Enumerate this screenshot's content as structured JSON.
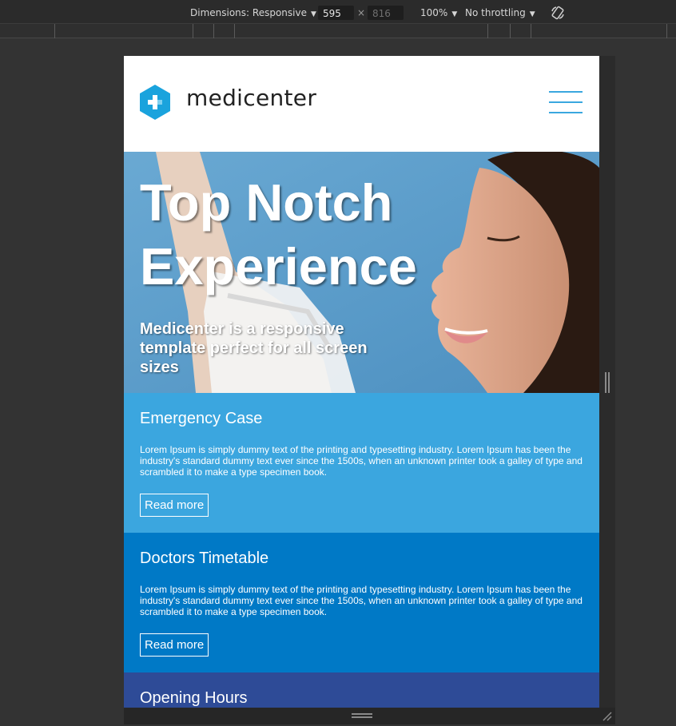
{
  "devtools": {
    "dimensions_label": "Dimensions: Responsive",
    "width_value": "595",
    "height_value": "816",
    "times": "×",
    "zoom": "100%",
    "throttling": "No throttling",
    "caret": "▼",
    "rotate_icon": "rotate-icon"
  },
  "site": {
    "logo_text": "medicenter",
    "logo_icon": "medical-cross-icon",
    "menu_icon": "hamburger-menu-icon",
    "brand_color": "#3aa7df"
  },
  "hero": {
    "title": "Top Notch Experience",
    "subtitle": "Medicenter is a responsive template perfect for all screen sizes"
  },
  "boxes": [
    {
      "title": "Emergency Case",
      "text": "Lorem Ipsum is simply dummy text of the printing and typesetting industry. Lorem Ipsum has been the industry's standard dummy text ever since the 1500s, when an unknown printer took a galley of type and scrambled it to make a type specimen book.",
      "button": "Read more",
      "color": "#3ba6df"
    },
    {
      "title": "Doctors Timetable",
      "text": "Lorem Ipsum is simply dummy text of the printing and typesetting industry. Lorem Ipsum has been the industry's standard dummy text ever since the 1500s, when an unknown printer took a galley of type and scrambled it to make a type specimen book.",
      "button": "Read more",
      "color": "#0079c6"
    },
    {
      "title": "Opening Hours",
      "color": "#2e4b97"
    }
  ]
}
